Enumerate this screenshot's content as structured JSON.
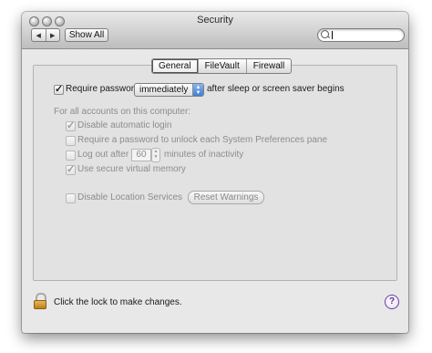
{
  "window": {
    "title": "Security"
  },
  "toolbar": {
    "back_glyph": "◀",
    "forward_glyph": "▶",
    "show_all_label": "Show All",
    "search_value": ""
  },
  "tabs": [
    {
      "label": "General",
      "active": true
    },
    {
      "label": "FileVault",
      "active": false
    },
    {
      "label": "Firewall",
      "active": false
    }
  ],
  "require_password": {
    "checked": true,
    "label": "Require password",
    "selected_option": "immediately",
    "suffix": "after sleep or screen saver begins"
  },
  "all_accounts_header": "For all accounts on this computer:",
  "options": {
    "disable_auto_login": {
      "label": "Disable automatic login",
      "checked": true,
      "enabled": false
    },
    "require_pw_prefs": {
      "label": "Require a password to unlock each System Preferences pane",
      "checked": false,
      "enabled": false
    },
    "log_out": {
      "label_before": "Log out after",
      "minutes": "60",
      "label_after": "minutes of inactivity",
      "checked": false,
      "enabled": false
    },
    "secure_vm": {
      "label": "Use secure virtual memory",
      "checked": true,
      "enabled": false
    },
    "disable_location": {
      "label": "Disable Location Services",
      "checked": false,
      "enabled": false
    }
  },
  "reset_warnings_label": "Reset Warnings",
  "footer": {
    "lock_text": "Click the lock to make changes.",
    "help_glyph": "?"
  },
  "icons": [
    "back-arrow-icon",
    "forward-arrow-icon",
    "search-icon",
    "lock-icon",
    "help-icon"
  ]
}
